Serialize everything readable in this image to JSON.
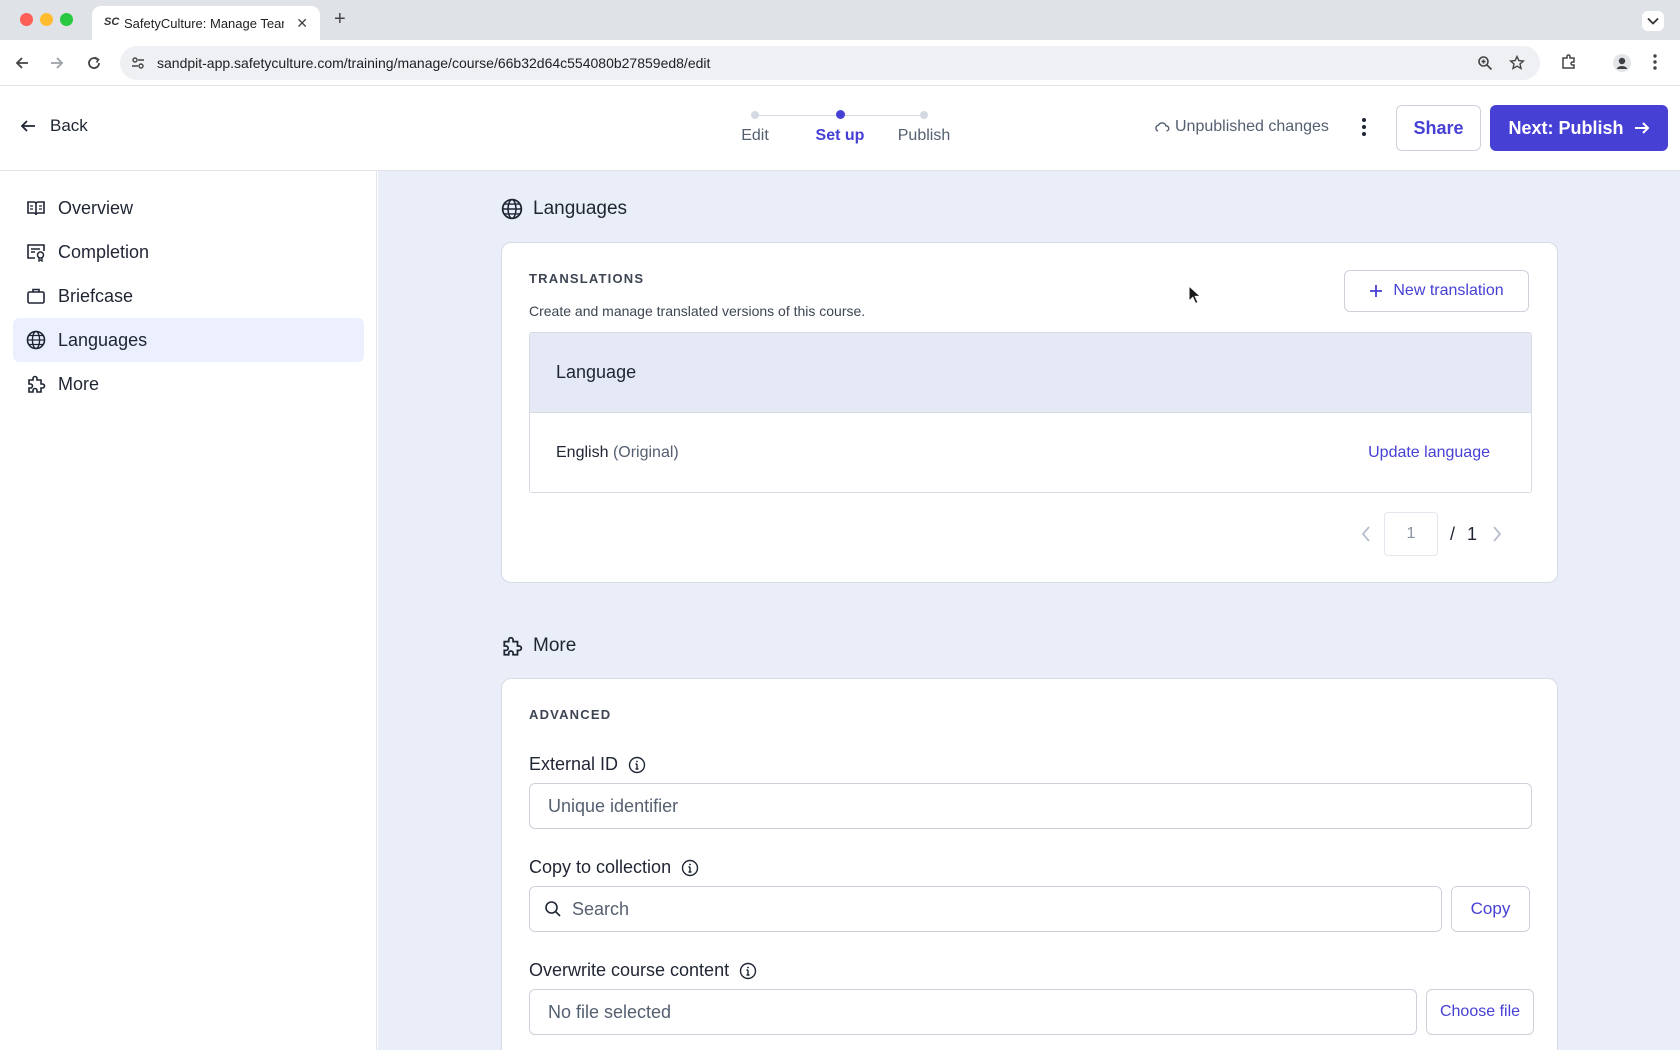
{
  "browser": {
    "tab_title": "SafetyCulture: Manage Teams",
    "tab_favicon": "SC",
    "url": "sandpit-app.safetyculture.com/training/manage/course/66b32d64c554080b27859ed8/edit"
  },
  "header": {
    "back_label": "Back",
    "steps": [
      {
        "label": "Edit",
        "active": false
      },
      {
        "label": "Set up",
        "active": true
      },
      {
        "label": "Publish",
        "active": false
      }
    ],
    "status": "Unpublished changes",
    "share_label": "Share",
    "next_label": "Next: Publish",
    "accent_color": "#4740d4"
  },
  "sidebar": {
    "items": [
      {
        "label": "Overview",
        "icon": "book-icon",
        "active": false
      },
      {
        "label": "Completion",
        "icon": "certificate-icon",
        "active": false
      },
      {
        "label": "Briefcase",
        "icon": "briefcase-icon",
        "active": false
      },
      {
        "label": "Languages",
        "icon": "globe-icon",
        "active": true
      },
      {
        "label": "More",
        "icon": "puzzle-icon",
        "active": false
      }
    ]
  },
  "languages_section": {
    "title": "Languages",
    "overline": "TRANSLATIONS",
    "description": "Create and manage translated versions of this course.",
    "new_translation_label": "New translation",
    "table_header": "Language",
    "rows": [
      {
        "language": "English",
        "note": "(Original)",
        "action": "Update language"
      }
    ],
    "pagination": {
      "current": "1",
      "separator": "/",
      "total": "1"
    }
  },
  "more_section": {
    "title": "More",
    "overline": "ADVANCED",
    "external_id": {
      "label": "External ID",
      "placeholder": "Unique identifier"
    },
    "copy_to_collection": {
      "label": "Copy to collection",
      "placeholder": "Search",
      "button": "Copy"
    },
    "overwrite": {
      "label": "Overwrite course content",
      "file_status": "No file selected",
      "button": "Choose file"
    }
  }
}
